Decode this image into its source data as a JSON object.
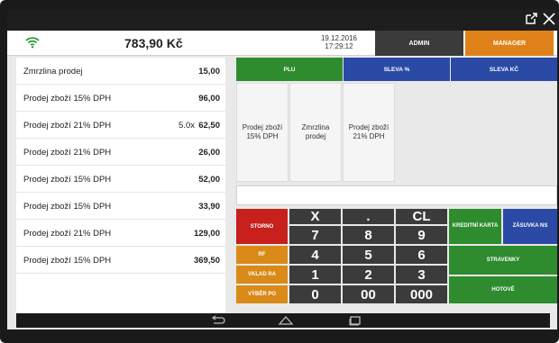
{
  "header": {
    "total": "783,90 Kč",
    "date": "19.12.2016",
    "time": "17:29:12",
    "admin_label": "ADMIN",
    "manager_label": "MANAGER"
  },
  "receipt": {
    "items": [
      {
        "name": "Zmrzlina prodej",
        "qty": "",
        "price": "15,00"
      },
      {
        "name": "Prodej zboží 15% DPH",
        "qty": "",
        "price": "96,00"
      },
      {
        "name": "Prodej zboží 21% DPH",
        "qty": "5.0x",
        "price": "62,50"
      },
      {
        "name": "Prodej zboží 21% DPH",
        "qty": "",
        "price": "26,00"
      },
      {
        "name": "Prodej zboží 15% DPH",
        "qty": "",
        "price": "52,00"
      },
      {
        "name": "Prodej zboží 15% DPH",
        "qty": "",
        "price": "33,90"
      },
      {
        "name": "Prodej zboží 21% DPH",
        "qty": "",
        "price": "129,00"
      },
      {
        "name": "Prodej zboží 15% DPH",
        "qty": "",
        "price": "369,50"
      }
    ]
  },
  "categories": {
    "plu": "PLU",
    "sleva_pct": "SLEVA %",
    "sleva_kc": "SLEVA KČ"
  },
  "products": [
    {
      "label": "Prodej zboží 15% DPH"
    },
    {
      "label": "Zmrzlina prodej"
    },
    {
      "label": "Prodej zboží 21% DPH"
    }
  ],
  "keypad": {
    "storno": "STORNO",
    "rf": "RF",
    "vklad": "VKLAD RA",
    "vyber": "VÝBĚR PO",
    "x": "X",
    "dot": ".",
    "cl": "CL",
    "n7": "7",
    "n8": "8",
    "n9": "9",
    "n4": "4",
    "n5": "5",
    "n6": "6",
    "n1": "1",
    "n2": "2",
    "n3": "3",
    "n0": "0",
    "n00": "00",
    "n000": "000",
    "kreditni_karta": "KREDITNÍ KARTA",
    "zasuvka_ns": "ZÁSUVKA NS",
    "stravenky": "STRAVENKY",
    "hotove": "HOTOVĚ"
  },
  "icons": {
    "wifi": "wifi-icon",
    "external": "external-link-icon",
    "close": "close-icon",
    "back": "back-icon",
    "home": "home-icon",
    "recents": "recents-icon"
  },
  "colors": {
    "green": "#2e8b2e",
    "blue": "#2a4aa6",
    "red": "#c8201c",
    "orange": "#d98a18",
    "dark": "#3b3b3b",
    "manager": "#e0821a"
  }
}
